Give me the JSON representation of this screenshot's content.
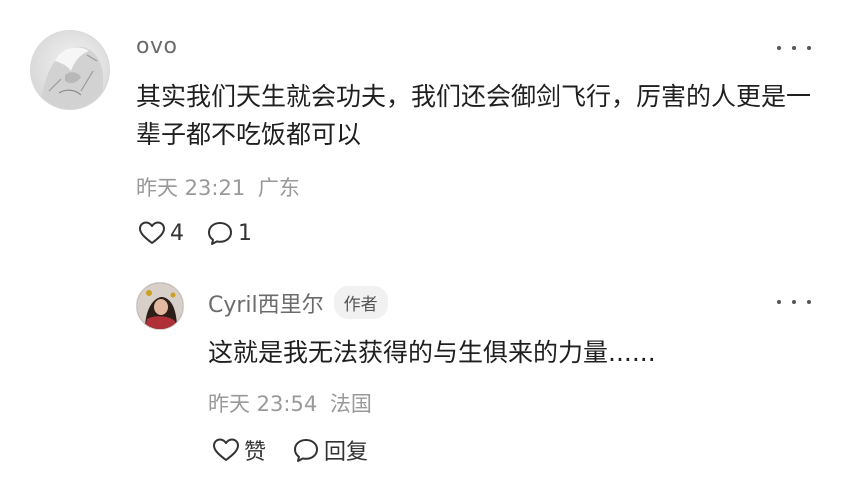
{
  "comment": {
    "username": "ovo",
    "text": "其实我们天生就会功夫，我们还会御剑飞行，厉害的人更是一辈子都不吃饭都可以",
    "time": "昨天 23:21",
    "location": "广东",
    "likes": "4",
    "replies": "1",
    "icons": {
      "like": "heart-icon",
      "reply": "comment-bubble-icon",
      "more": "more-dots-icon"
    }
  },
  "reply": {
    "username": "Cyril西里尔",
    "badge": "作者",
    "text": "这就是我无法获得的与生俱来的力量......",
    "time": "昨天 23:54",
    "location": "法国",
    "like_label": "赞",
    "reply_label": "回复"
  }
}
